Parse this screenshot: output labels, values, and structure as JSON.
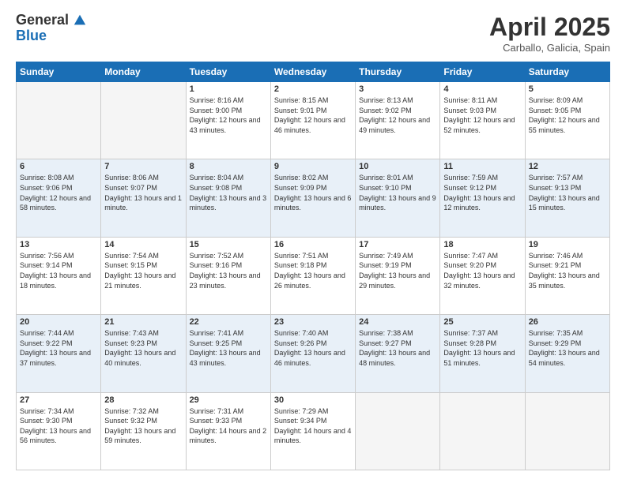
{
  "logo": {
    "line1": "General",
    "line2": "Blue"
  },
  "title": "April 2025",
  "location": "Carballo, Galicia, Spain",
  "weekdays": [
    "Sunday",
    "Monday",
    "Tuesday",
    "Wednesday",
    "Thursday",
    "Friday",
    "Saturday"
  ],
  "weeks": [
    [
      {
        "day": "",
        "info": ""
      },
      {
        "day": "",
        "info": ""
      },
      {
        "day": "1",
        "info": "Sunrise: 8:16 AM\nSunset: 9:00 PM\nDaylight: 12 hours and 43 minutes."
      },
      {
        "day": "2",
        "info": "Sunrise: 8:15 AM\nSunset: 9:01 PM\nDaylight: 12 hours and 46 minutes."
      },
      {
        "day": "3",
        "info": "Sunrise: 8:13 AM\nSunset: 9:02 PM\nDaylight: 12 hours and 49 minutes."
      },
      {
        "day": "4",
        "info": "Sunrise: 8:11 AM\nSunset: 9:03 PM\nDaylight: 12 hours and 52 minutes."
      },
      {
        "day": "5",
        "info": "Sunrise: 8:09 AM\nSunset: 9:05 PM\nDaylight: 12 hours and 55 minutes."
      }
    ],
    [
      {
        "day": "6",
        "info": "Sunrise: 8:08 AM\nSunset: 9:06 PM\nDaylight: 12 hours and 58 minutes."
      },
      {
        "day": "7",
        "info": "Sunrise: 8:06 AM\nSunset: 9:07 PM\nDaylight: 13 hours and 1 minute."
      },
      {
        "day": "8",
        "info": "Sunrise: 8:04 AM\nSunset: 9:08 PM\nDaylight: 13 hours and 3 minutes."
      },
      {
        "day": "9",
        "info": "Sunrise: 8:02 AM\nSunset: 9:09 PM\nDaylight: 13 hours and 6 minutes."
      },
      {
        "day": "10",
        "info": "Sunrise: 8:01 AM\nSunset: 9:10 PM\nDaylight: 13 hours and 9 minutes."
      },
      {
        "day": "11",
        "info": "Sunrise: 7:59 AM\nSunset: 9:12 PM\nDaylight: 13 hours and 12 minutes."
      },
      {
        "day": "12",
        "info": "Sunrise: 7:57 AM\nSunset: 9:13 PM\nDaylight: 13 hours and 15 minutes."
      }
    ],
    [
      {
        "day": "13",
        "info": "Sunrise: 7:56 AM\nSunset: 9:14 PM\nDaylight: 13 hours and 18 minutes."
      },
      {
        "day": "14",
        "info": "Sunrise: 7:54 AM\nSunset: 9:15 PM\nDaylight: 13 hours and 21 minutes."
      },
      {
        "day": "15",
        "info": "Sunrise: 7:52 AM\nSunset: 9:16 PM\nDaylight: 13 hours and 23 minutes."
      },
      {
        "day": "16",
        "info": "Sunrise: 7:51 AM\nSunset: 9:18 PM\nDaylight: 13 hours and 26 minutes."
      },
      {
        "day": "17",
        "info": "Sunrise: 7:49 AM\nSunset: 9:19 PM\nDaylight: 13 hours and 29 minutes."
      },
      {
        "day": "18",
        "info": "Sunrise: 7:47 AM\nSunset: 9:20 PM\nDaylight: 13 hours and 32 minutes."
      },
      {
        "day": "19",
        "info": "Sunrise: 7:46 AM\nSunset: 9:21 PM\nDaylight: 13 hours and 35 minutes."
      }
    ],
    [
      {
        "day": "20",
        "info": "Sunrise: 7:44 AM\nSunset: 9:22 PM\nDaylight: 13 hours and 37 minutes."
      },
      {
        "day": "21",
        "info": "Sunrise: 7:43 AM\nSunset: 9:23 PM\nDaylight: 13 hours and 40 minutes."
      },
      {
        "day": "22",
        "info": "Sunrise: 7:41 AM\nSunset: 9:25 PM\nDaylight: 13 hours and 43 minutes."
      },
      {
        "day": "23",
        "info": "Sunrise: 7:40 AM\nSunset: 9:26 PM\nDaylight: 13 hours and 46 minutes."
      },
      {
        "day": "24",
        "info": "Sunrise: 7:38 AM\nSunset: 9:27 PM\nDaylight: 13 hours and 48 minutes."
      },
      {
        "day": "25",
        "info": "Sunrise: 7:37 AM\nSunset: 9:28 PM\nDaylight: 13 hours and 51 minutes."
      },
      {
        "day": "26",
        "info": "Sunrise: 7:35 AM\nSunset: 9:29 PM\nDaylight: 13 hours and 54 minutes."
      }
    ],
    [
      {
        "day": "27",
        "info": "Sunrise: 7:34 AM\nSunset: 9:30 PM\nDaylight: 13 hours and 56 minutes."
      },
      {
        "day": "28",
        "info": "Sunrise: 7:32 AM\nSunset: 9:32 PM\nDaylight: 13 hours and 59 minutes."
      },
      {
        "day": "29",
        "info": "Sunrise: 7:31 AM\nSunset: 9:33 PM\nDaylight: 14 hours and 2 minutes."
      },
      {
        "day": "30",
        "info": "Sunrise: 7:29 AM\nSunset: 9:34 PM\nDaylight: 14 hours and 4 minutes."
      },
      {
        "day": "",
        "info": ""
      },
      {
        "day": "",
        "info": ""
      },
      {
        "day": "",
        "info": ""
      }
    ]
  ]
}
